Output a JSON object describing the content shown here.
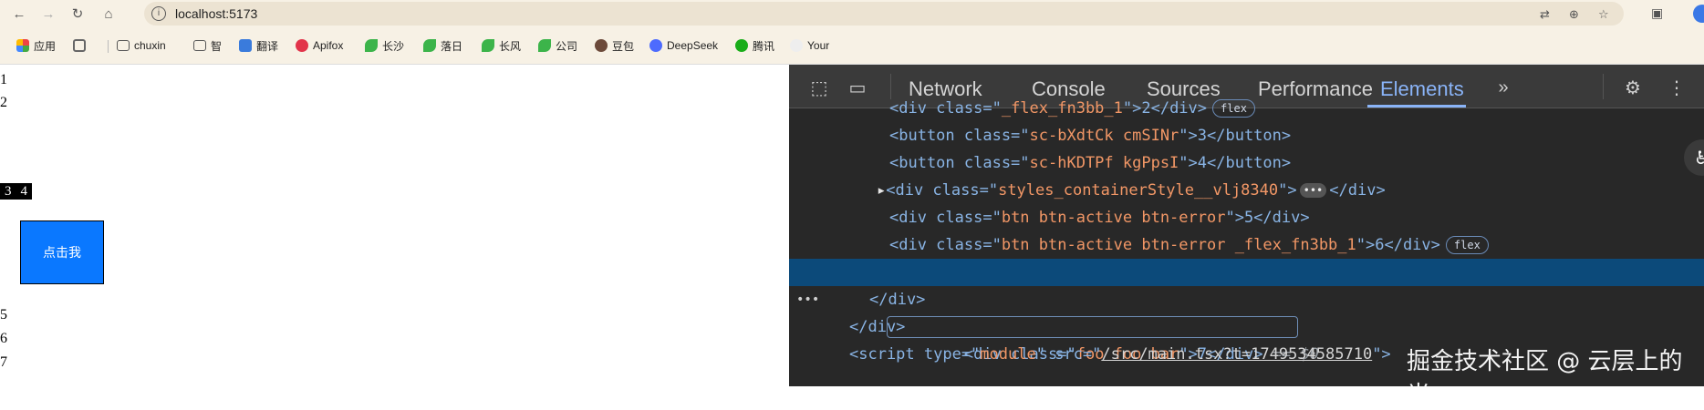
{
  "browser": {
    "url": "localhost:5173",
    "bookmarks": [
      "应用",
      "chuxin",
      "智",
      "翻译",
      "Apifox",
      "长沙",
      "落日",
      "长风",
      "公司",
      "豆包",
      "DeepSeek",
      "腾讯",
      "Your"
    ]
  },
  "page": {
    "lines_top": [
      "1",
      "2"
    ],
    "flex_items": [
      "3",
      "4"
    ],
    "button_label": "点击我",
    "lines_bottom": [
      "5",
      "6",
      "7"
    ]
  },
  "devtools": {
    "tabs": [
      "Network",
      "Console",
      "Sources",
      "Performance",
      "Elements"
    ],
    "active_tab": "Elements",
    "rows": [
      {
        "open": "<div class=\"",
        "attr": "_flex_fn3bb_1",
        "close": "\">2</div>",
        "badge": "flex"
      },
      {
        "open": "<button class=\"",
        "attr": "sc-bXdtCk cmSINr",
        "close": "\">3</button>"
      },
      {
        "open": "<button class=\"",
        "attr": "sc-hKDTPf kgPpsI",
        "close": "\">4</button>"
      },
      {
        "open": "<div class=\"",
        "attr": "styles_containerStyle__vlj8340",
        "close": "\">",
        "dots": "•••",
        "tail": "</div>"
      },
      {
        "open": "<div class=\"",
        "attr": "btn btn-active btn-error",
        "close": "\">5</div>"
      },
      {
        "open": "<div class=\"",
        "attr": "btn btn-active btn-error _flex_fn3bb_1",
        "close": "\">6</div>",
        "badge": "flex"
      },
      {
        "open": "<div class=\"",
        "attr": "foo foo bar",
        "close": "\">7</div>",
        "eq": "== $0"
      },
      {
        "text": "</div>"
      },
      {
        "text": "</div>"
      },
      {
        "open": "<script type=\"",
        "attr": "module",
        "mid": "\" src=\"",
        "link": "/src/main.tsx?t=1749534585710",
        "close": "\">"
      }
    ]
  },
  "watermark": "掘金技术社区 @ 云层上的光"
}
